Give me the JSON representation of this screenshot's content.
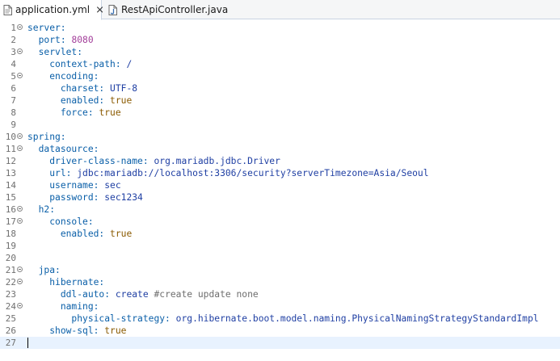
{
  "tabs": [
    {
      "label": "application.yml",
      "close": "⨯",
      "active": true,
      "icon": "yaml-file-icon"
    },
    {
      "label": "RestApiController.java",
      "active": false,
      "icon": "java-file-icon"
    }
  ],
  "lines": [
    {
      "n": "1",
      "fold": true,
      "key": "server:",
      "val": "",
      "cls": ""
    },
    {
      "n": "2",
      "fold": false,
      "indent": "  ",
      "key": "port:",
      "val": "8080",
      "cls": "num"
    },
    {
      "n": "3",
      "fold": true,
      "indent": "  ",
      "key": "servlet:",
      "val": "",
      "cls": ""
    },
    {
      "n": "4",
      "fold": false,
      "indent": "    ",
      "key": "context-path:",
      "val": "/",
      "cls": "v"
    },
    {
      "n": "5",
      "fold": true,
      "indent": "    ",
      "key": "encoding:",
      "val": "",
      "cls": ""
    },
    {
      "n": "6",
      "fold": false,
      "indent": "      ",
      "key": "charset:",
      "val": "UTF-8",
      "cls": "v"
    },
    {
      "n": "7",
      "fold": false,
      "indent": "      ",
      "key": "enabled:",
      "val": "true",
      "cls": "bool"
    },
    {
      "n": "8",
      "fold": false,
      "indent": "      ",
      "key": "force:",
      "val": "true",
      "cls": "bool"
    },
    {
      "n": "9",
      "fold": false,
      "indent": "",
      "key": "",
      "val": "",
      "cls": ""
    },
    {
      "n": "10",
      "fold": true,
      "indent": "",
      "key": "spring:",
      "val": "",
      "cls": ""
    },
    {
      "n": "11",
      "fold": true,
      "indent": "  ",
      "key": "datasource:",
      "val": "",
      "cls": ""
    },
    {
      "n": "12",
      "fold": false,
      "indent": "    ",
      "key": "driver-class-name:",
      "val": "org.mariadb.jdbc.Driver",
      "cls": "v"
    },
    {
      "n": "13",
      "fold": false,
      "indent": "    ",
      "key": "url:",
      "val": "jdbc:mariadb://localhost:3306/security?serverTimezone=Asia/Seoul",
      "cls": "v"
    },
    {
      "n": "14",
      "fold": false,
      "indent": "    ",
      "key": "username:",
      "val": "sec",
      "cls": "v"
    },
    {
      "n": "15",
      "fold": false,
      "indent": "    ",
      "key": "password:",
      "val": "sec1234",
      "cls": "v"
    },
    {
      "n": "16",
      "fold": true,
      "indent": "  ",
      "key": "h2:",
      "val": "",
      "cls": ""
    },
    {
      "n": "17",
      "fold": true,
      "indent": "    ",
      "key": "console:",
      "val": "",
      "cls": ""
    },
    {
      "n": "18",
      "fold": false,
      "indent": "      ",
      "key": "enabled:",
      "val": "true",
      "cls": "bool"
    },
    {
      "n": "19",
      "fold": false,
      "indent": "",
      "key": "",
      "val": "",
      "cls": ""
    },
    {
      "n": "20",
      "fold": false,
      "indent": "",
      "key": "",
      "val": "",
      "cls": ""
    },
    {
      "n": "21",
      "fold": true,
      "indent": "  ",
      "key": "jpa:",
      "val": "",
      "cls": ""
    },
    {
      "n": "22",
      "fold": true,
      "indent": "    ",
      "key": "hibernate:",
      "val": "",
      "cls": ""
    },
    {
      "n": "23",
      "fold": false,
      "indent": "      ",
      "key": "ddl-auto:",
      "val": "create",
      "cls": "v",
      "comment": "#create update none"
    },
    {
      "n": "24",
      "fold": true,
      "indent": "      ",
      "key": "naming:",
      "val": "",
      "cls": ""
    },
    {
      "n": "25",
      "fold": false,
      "indent": "        ",
      "key": "physical-strategy:",
      "val": "org.hibernate.boot.model.naming.PhysicalNamingStrategyStandardImpl",
      "cls": "v"
    },
    {
      "n": "26",
      "fold": false,
      "indent": "    ",
      "key": "show-sql:",
      "val": "true",
      "cls": "bool"
    },
    {
      "n": "27",
      "fold": false,
      "indent": "",
      "key": "",
      "val": "",
      "cls": "",
      "current": true
    }
  ]
}
